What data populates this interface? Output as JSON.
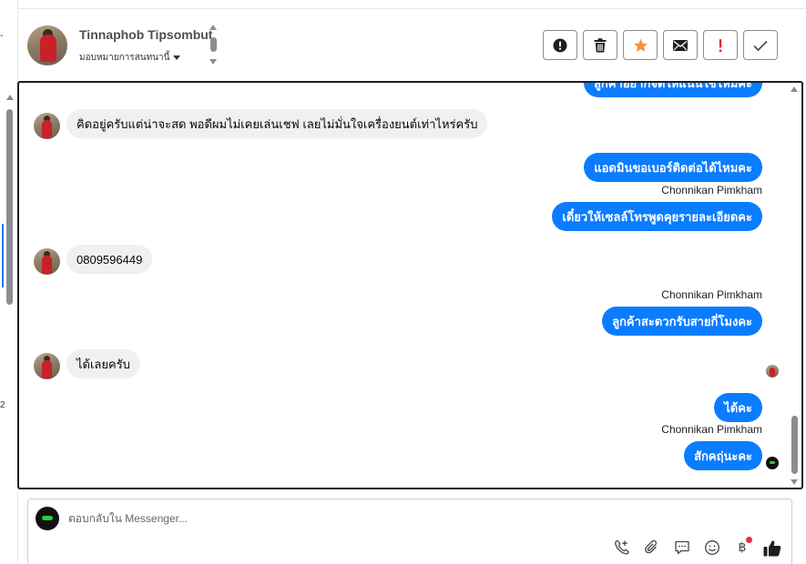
{
  "sidebar_left": {
    "tick_marks": [
      "-",
      "2"
    ]
  },
  "header": {
    "contact_name": "Tinnaphob Tipsombut",
    "assign_label": "มอบหมายการสนทนานี้",
    "actions": [
      {
        "name": "report-spam-button",
        "icon": "exclamation-circle-icon"
      },
      {
        "name": "delete-button",
        "icon": "trash-icon"
      },
      {
        "name": "star-button",
        "icon": "star-icon"
      },
      {
        "name": "mark-unread-button",
        "icon": "envelope-icon"
      },
      {
        "name": "mark-important-button",
        "icon": "exclamation-icon"
      },
      {
        "name": "mark-done-button",
        "icon": "check-icon"
      }
    ]
  },
  "conversation": {
    "top_partial": "ลูกค้าอยากจัดให้แน่นใช่ไหมคะ",
    "messages": [
      {
        "dir": "in",
        "text": "คิดอยู่ครับแต่น่าจะสด พอดีผมไม่เคยเล่นเชฟ เลยไม่มั่นใจเครื่องยนต์เท่าไหร่ครับ"
      },
      {
        "dir": "out",
        "text": "แอดมินขอเบอร์ติดต่อได้ไหมคะ"
      },
      {
        "dir": "out",
        "sender": "Chonnikan Pimkham",
        "text": "เดี๋ยวให้เซลล์โทรพูดคุยรายละเอียดคะ"
      },
      {
        "dir": "in",
        "text": "0809596449"
      },
      {
        "dir": "out",
        "sender": "Chonnikan Pimkham",
        "text": "ลูกค้าสะดวกรับสายกี่โมงคะ"
      },
      {
        "dir": "in",
        "text": "ได้เลยครับ"
      },
      {
        "dir": "out",
        "text": "ได้คะ"
      },
      {
        "dir": "out",
        "sender": "Chonnikan Pimkham",
        "text": "สักคฤ่นะคะ"
      }
    ]
  },
  "composer": {
    "placeholder": "ตอบกลับใน Messenger...",
    "value": "",
    "tools": [
      "call-add-icon",
      "attachment-icon",
      "saved-reply-icon",
      "emoji-icon",
      "baht-icon",
      "like-icon"
    ],
    "baht_symbol": "฿"
  },
  "colors": {
    "outgoing_bubble": "#0a7cff",
    "incoming_bubble": "#f0f0f0",
    "star": "#f7923b",
    "important": "#e41e3f",
    "notification_dot": "#f02849"
  }
}
